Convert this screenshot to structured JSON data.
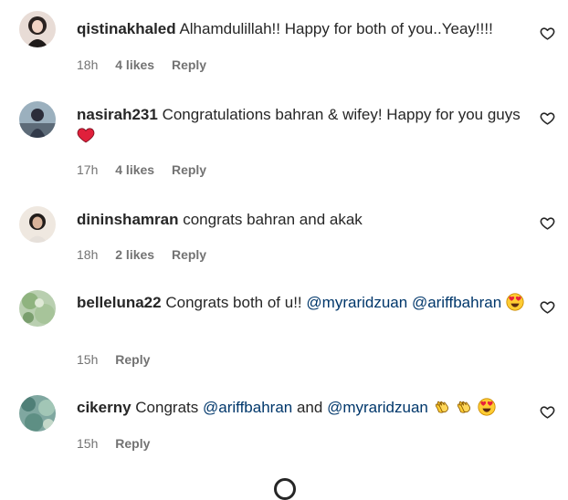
{
  "comments": [
    {
      "username": "qistinakhaled",
      "text": "Alhamdulillah!! Happy for both of you..Yeay!!!!",
      "time": "18h",
      "likes": "4 likes",
      "reply": "Reply",
      "avatar_icon": "avatar-photo",
      "like_icon": "heart-outline-icon"
    },
    {
      "username": "nasirah231",
      "text": "Congratulations bahran & wifey! Happy for you guys",
      "emoji": "red-heart-emoji",
      "time": "17h",
      "likes": "4 likes",
      "reply": "Reply",
      "avatar_icon": "avatar-photo",
      "like_icon": "heart-outline-icon"
    },
    {
      "username": "dininshamran",
      "text": "congrats bahran and akak",
      "time": "18h",
      "likes": "2 likes",
      "reply": "Reply",
      "avatar_icon": "avatar-photo",
      "like_icon": "heart-outline-icon"
    },
    {
      "username": "belleluna22",
      "text": "Congrats both of u!!",
      "mention_1": "@myraridzuan",
      "mention_2": "@ariffbahran",
      "emoji": "heart-eyes-emoji",
      "time": "15h",
      "reply": "Reply",
      "avatar_icon": "avatar-photo",
      "like_icon": "heart-outline-icon"
    },
    {
      "username": "cikerny",
      "text": "Congrats",
      "mention_1": "@ariffbahran",
      "conjunction": "and",
      "mention_2": "@myraridzuan",
      "emojis": [
        "clapping-hands-emoji",
        "clapping-hands-emoji",
        "heart-eyes-emoji"
      ],
      "time": "15h",
      "reply": "Reply",
      "avatar_icon": "avatar-photo",
      "like_icon": "heart-outline-icon"
    }
  ],
  "colors": {
    "text": "#262626",
    "meta": "#737373",
    "mention": "#00376b",
    "background": "#ffffff"
  },
  "loading_icon": "loading-spinner-icon"
}
